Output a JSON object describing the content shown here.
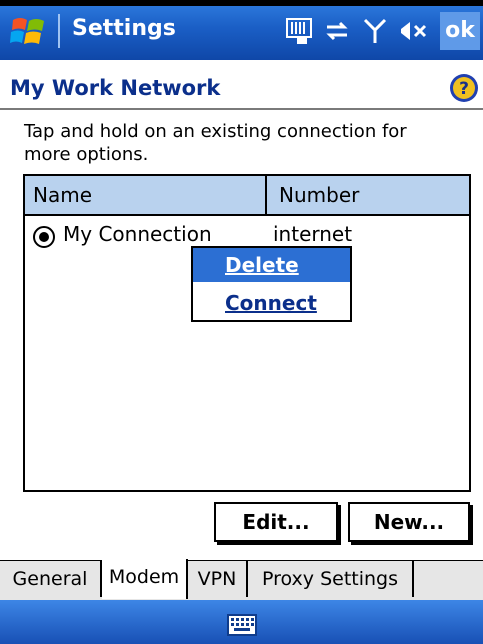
{
  "titlebar": {
    "title": "Settings",
    "ok_label": "ok"
  },
  "header": {
    "page_title": "My Work Network"
  },
  "instructions": "Tap and hold on an existing connection for more options.",
  "list": {
    "columns": [
      "Name",
      "Number"
    ],
    "rows": [
      {
        "name": "My Connection",
        "number": "internet",
        "selected": true
      }
    ]
  },
  "context_menu": {
    "items": [
      "Delete",
      "Connect"
    ]
  },
  "buttons": {
    "edit": "Edit...",
    "new": "New..."
  },
  "tabs": [
    "General",
    "Modem",
    "VPN",
    "Proxy Settings"
  ],
  "active_tab": "Modem",
  "icons": [
    "windows-start-icon",
    "signal-sim-icon",
    "connectivity-icon",
    "antenna-icon",
    "mute-icon",
    "help-icon",
    "keyboard-icon"
  ],
  "colors": {
    "titlebar": "#1b5fc6",
    "page_title": "#0b2f8b",
    "list_header": "#b9d2ee",
    "menu_highlight": "#2c6fd3"
  }
}
